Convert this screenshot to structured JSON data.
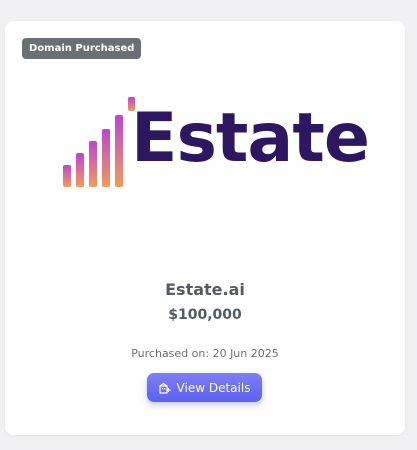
{
  "card": {
    "badge": "Domain Purchased",
    "logo": {
      "word": "Estate",
      "colors": {
        "bars_top": "#c043d3",
        "bars_bottom": "#f39b58",
        "wordmark": "#2d1760"
      }
    },
    "domain_name": "Estate.ai",
    "price": "$100,000",
    "purchased_on": "Purchased on: 20 Jun 2025",
    "button": {
      "label": "View Details",
      "icon": "building-icon",
      "color": "#6870f0"
    }
  }
}
